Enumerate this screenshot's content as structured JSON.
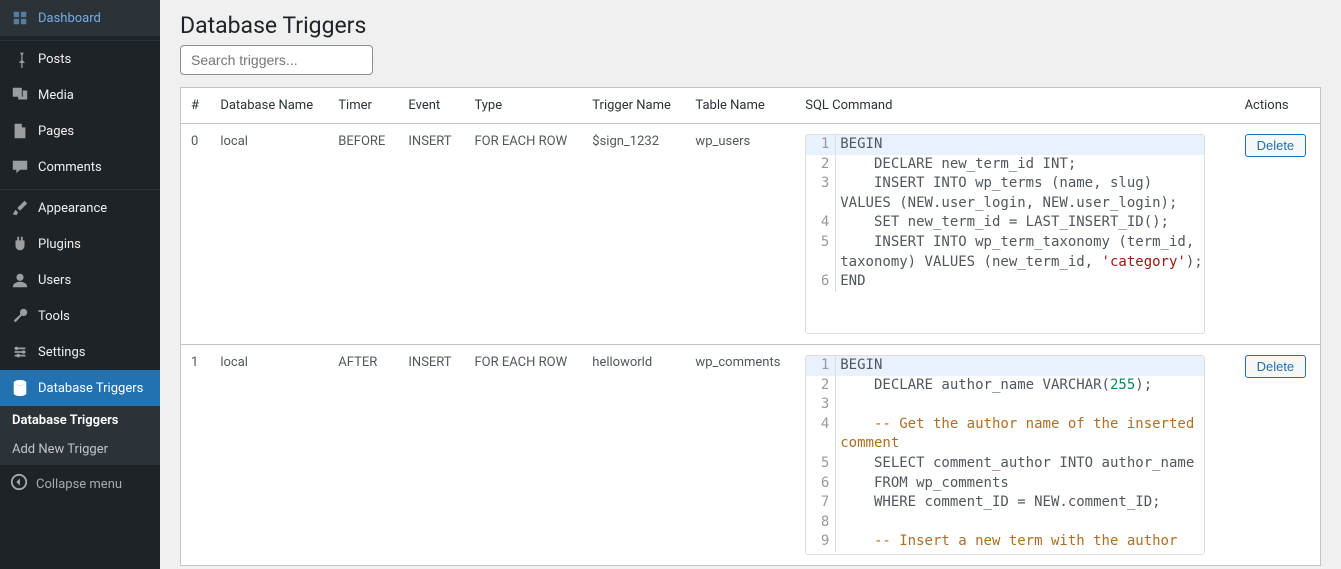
{
  "sidebar": {
    "items": [
      {
        "label": "Dashboard",
        "icon": "dashboard"
      },
      {
        "label": "Posts",
        "icon": "pin"
      },
      {
        "label": "Media",
        "icon": "media"
      },
      {
        "label": "Pages",
        "icon": "pages"
      },
      {
        "label": "Comments",
        "icon": "comments"
      },
      {
        "label": "Appearance",
        "icon": "brush"
      },
      {
        "label": "Plugins",
        "icon": "plug"
      },
      {
        "label": "Users",
        "icon": "user"
      },
      {
        "label": "Tools",
        "icon": "wrench"
      },
      {
        "label": "Settings",
        "icon": "settings"
      },
      {
        "label": "Database Triggers",
        "icon": "database"
      }
    ],
    "subnav": {
      "items": [
        {
          "label": "Database Triggers",
          "current": true
        },
        {
          "label": "Add New Trigger",
          "current": false
        }
      ]
    },
    "collapse_label": "Collapse menu"
  },
  "page": {
    "title": "Database Triggers",
    "search_placeholder": "Search triggers..."
  },
  "table": {
    "headers": {
      "idx": "#",
      "db": "Database Name",
      "timer": "Timer",
      "event": "Event",
      "type": "Type",
      "trigger": "Trigger Name",
      "table": "Table Name",
      "sql": "SQL Command",
      "actions": "Actions"
    },
    "rows": [
      {
        "idx": "0",
        "db": "local",
        "timer": "BEFORE",
        "event": "INSERT",
        "type": "FOR EACH ROW",
        "trigger": "$sign_1232",
        "table": "wp_users",
        "sql_lines": [
          [
            "BEGIN"
          ],
          [
            "    DECLARE new_term_id INT;"
          ],
          [
            "    INSERT INTO wp_terms (name, slug) VALUES (NEW.user_login, NEW.user_login);"
          ],
          [
            "    SET new_term_id = LAST_INSERT_ID();"
          ],
          [
            "    INSERT INTO wp_term_taxonomy (term_id, taxonomy) VALUES (new_term_id, ",
            "'category'",
            ");"
          ],
          [
            "END"
          ]
        ],
        "delete_label": "Delete"
      },
      {
        "idx": "1",
        "db": "local",
        "timer": "AFTER",
        "event": "INSERT",
        "type": "FOR EACH ROW",
        "trigger": "helloworld",
        "table": "wp_comments",
        "sql_lines": [
          [
            "BEGIN"
          ],
          [
            "    DECLARE author_name VARCHAR(",
            "255",
            ");"
          ],
          [
            ""
          ],
          [
            "    ",
            "-- Get the author name of the inserted comment"
          ],
          [
            "    SELECT comment_author INTO author_name"
          ],
          [
            "    FROM wp_comments"
          ],
          [
            "    WHERE comment_ID = NEW.comment_ID;"
          ],
          [
            ""
          ],
          [
            "    ",
            "-- Insert a new term with the author"
          ]
        ],
        "delete_label": "Delete"
      }
    ]
  }
}
